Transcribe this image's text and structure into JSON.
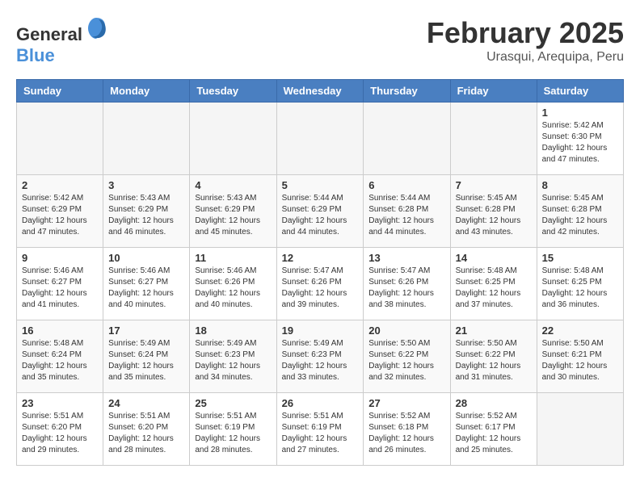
{
  "header": {
    "logo_general": "General",
    "logo_blue": "Blue",
    "title": "February 2025",
    "subtitle": "Urasqui, Arequipa, Peru"
  },
  "weekdays": [
    "Sunday",
    "Monday",
    "Tuesday",
    "Wednesday",
    "Thursday",
    "Friday",
    "Saturday"
  ],
  "weeks": [
    [
      {
        "num": "",
        "info": ""
      },
      {
        "num": "",
        "info": ""
      },
      {
        "num": "",
        "info": ""
      },
      {
        "num": "",
        "info": ""
      },
      {
        "num": "",
        "info": ""
      },
      {
        "num": "",
        "info": ""
      },
      {
        "num": "1",
        "info": "Sunrise: 5:42 AM\nSunset: 6:30 PM\nDaylight: 12 hours\nand 47 minutes."
      }
    ],
    [
      {
        "num": "2",
        "info": "Sunrise: 5:42 AM\nSunset: 6:29 PM\nDaylight: 12 hours\nand 47 minutes."
      },
      {
        "num": "3",
        "info": "Sunrise: 5:43 AM\nSunset: 6:29 PM\nDaylight: 12 hours\nand 46 minutes."
      },
      {
        "num": "4",
        "info": "Sunrise: 5:43 AM\nSunset: 6:29 PM\nDaylight: 12 hours\nand 45 minutes."
      },
      {
        "num": "5",
        "info": "Sunrise: 5:44 AM\nSunset: 6:29 PM\nDaylight: 12 hours\nand 44 minutes."
      },
      {
        "num": "6",
        "info": "Sunrise: 5:44 AM\nSunset: 6:28 PM\nDaylight: 12 hours\nand 44 minutes."
      },
      {
        "num": "7",
        "info": "Sunrise: 5:45 AM\nSunset: 6:28 PM\nDaylight: 12 hours\nand 43 minutes."
      },
      {
        "num": "8",
        "info": "Sunrise: 5:45 AM\nSunset: 6:28 PM\nDaylight: 12 hours\nand 42 minutes."
      }
    ],
    [
      {
        "num": "9",
        "info": "Sunrise: 5:46 AM\nSunset: 6:27 PM\nDaylight: 12 hours\nand 41 minutes."
      },
      {
        "num": "10",
        "info": "Sunrise: 5:46 AM\nSunset: 6:27 PM\nDaylight: 12 hours\nand 40 minutes."
      },
      {
        "num": "11",
        "info": "Sunrise: 5:46 AM\nSunset: 6:26 PM\nDaylight: 12 hours\nand 40 minutes."
      },
      {
        "num": "12",
        "info": "Sunrise: 5:47 AM\nSunset: 6:26 PM\nDaylight: 12 hours\nand 39 minutes."
      },
      {
        "num": "13",
        "info": "Sunrise: 5:47 AM\nSunset: 6:26 PM\nDaylight: 12 hours\nand 38 minutes."
      },
      {
        "num": "14",
        "info": "Sunrise: 5:48 AM\nSunset: 6:25 PM\nDaylight: 12 hours\nand 37 minutes."
      },
      {
        "num": "15",
        "info": "Sunrise: 5:48 AM\nSunset: 6:25 PM\nDaylight: 12 hours\nand 36 minutes."
      }
    ],
    [
      {
        "num": "16",
        "info": "Sunrise: 5:48 AM\nSunset: 6:24 PM\nDaylight: 12 hours\nand 35 minutes."
      },
      {
        "num": "17",
        "info": "Sunrise: 5:49 AM\nSunset: 6:24 PM\nDaylight: 12 hours\nand 35 minutes."
      },
      {
        "num": "18",
        "info": "Sunrise: 5:49 AM\nSunset: 6:23 PM\nDaylight: 12 hours\nand 34 minutes."
      },
      {
        "num": "19",
        "info": "Sunrise: 5:49 AM\nSunset: 6:23 PM\nDaylight: 12 hours\nand 33 minutes."
      },
      {
        "num": "20",
        "info": "Sunrise: 5:50 AM\nSunset: 6:22 PM\nDaylight: 12 hours\nand 32 minutes."
      },
      {
        "num": "21",
        "info": "Sunrise: 5:50 AM\nSunset: 6:22 PM\nDaylight: 12 hours\nand 31 minutes."
      },
      {
        "num": "22",
        "info": "Sunrise: 5:50 AM\nSunset: 6:21 PM\nDaylight: 12 hours\nand 30 minutes."
      }
    ],
    [
      {
        "num": "23",
        "info": "Sunrise: 5:51 AM\nSunset: 6:20 PM\nDaylight: 12 hours\nand 29 minutes."
      },
      {
        "num": "24",
        "info": "Sunrise: 5:51 AM\nSunset: 6:20 PM\nDaylight: 12 hours\nand 28 minutes."
      },
      {
        "num": "25",
        "info": "Sunrise: 5:51 AM\nSunset: 6:19 PM\nDaylight: 12 hours\nand 28 minutes."
      },
      {
        "num": "26",
        "info": "Sunrise: 5:51 AM\nSunset: 6:19 PM\nDaylight: 12 hours\nand 27 minutes."
      },
      {
        "num": "27",
        "info": "Sunrise: 5:52 AM\nSunset: 6:18 PM\nDaylight: 12 hours\nand 26 minutes."
      },
      {
        "num": "28",
        "info": "Sunrise: 5:52 AM\nSunset: 6:17 PM\nDaylight: 12 hours\nand 25 minutes."
      },
      {
        "num": "",
        "info": ""
      }
    ]
  ]
}
